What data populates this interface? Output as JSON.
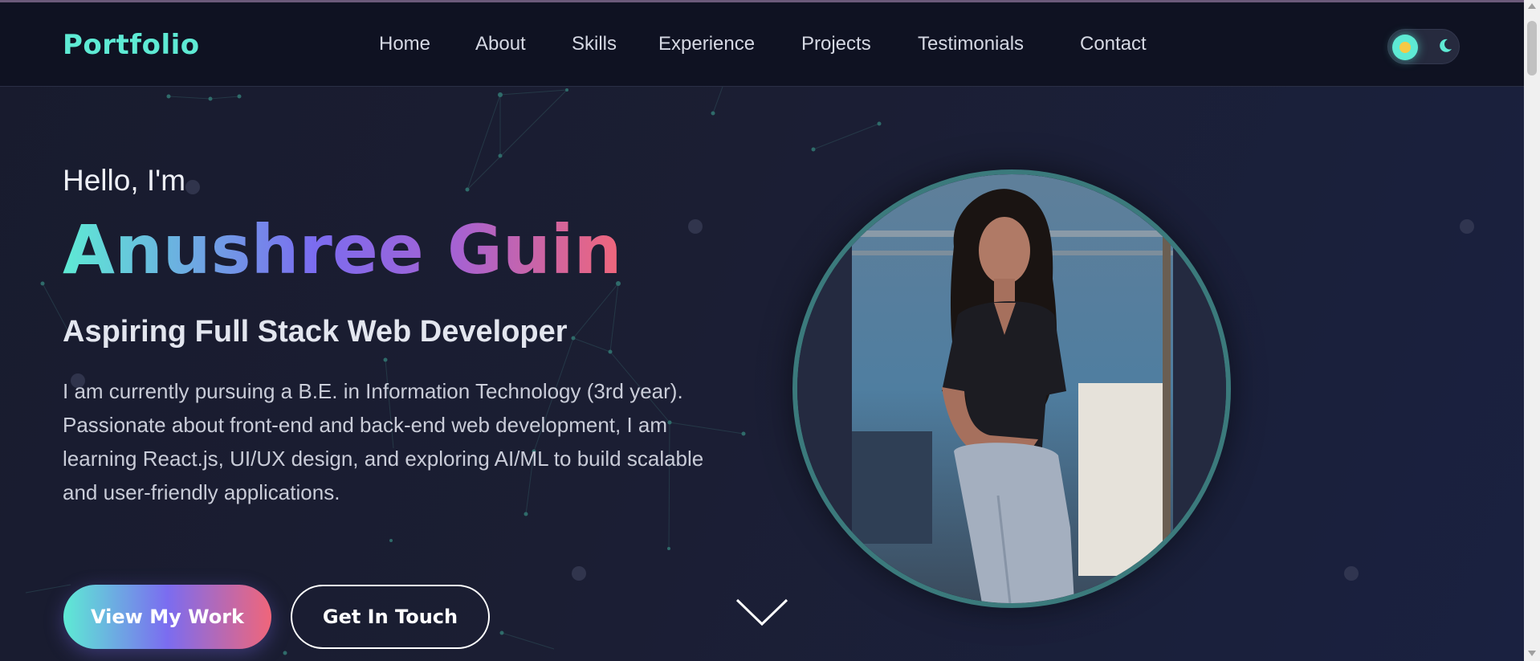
{
  "navbar": {
    "logo": "Portfolio",
    "links": [
      "Home",
      "About",
      "Skills",
      "Experience",
      "Projects",
      "Testimonials",
      "Contact"
    ]
  },
  "hero": {
    "greeting": "Hello, I'm",
    "name": "Anushree Guin",
    "role": "Aspiring Full Stack Web Developer",
    "bio": "I am currently pursuing a B.E. in Information Technology (3rd year). Passionate about front-end and back-end web development, I am learning React.js, UI/UX design, and exploring AI/ML to build scalable and user-friendly applications.",
    "primary_button": "View My Work",
    "secondary_button": "Get In Touch"
  },
  "colors": {
    "accent": "#5eead4",
    "gradient_mid": "#7b6cf0",
    "gradient_end": "#f0667a",
    "navbar_bg": "#0f1222",
    "page_bg": "#181b2e"
  },
  "icons": {
    "theme_light": "sun-icon",
    "theme_dark": "moon-icon",
    "scroll": "chevron-down-icon"
  }
}
